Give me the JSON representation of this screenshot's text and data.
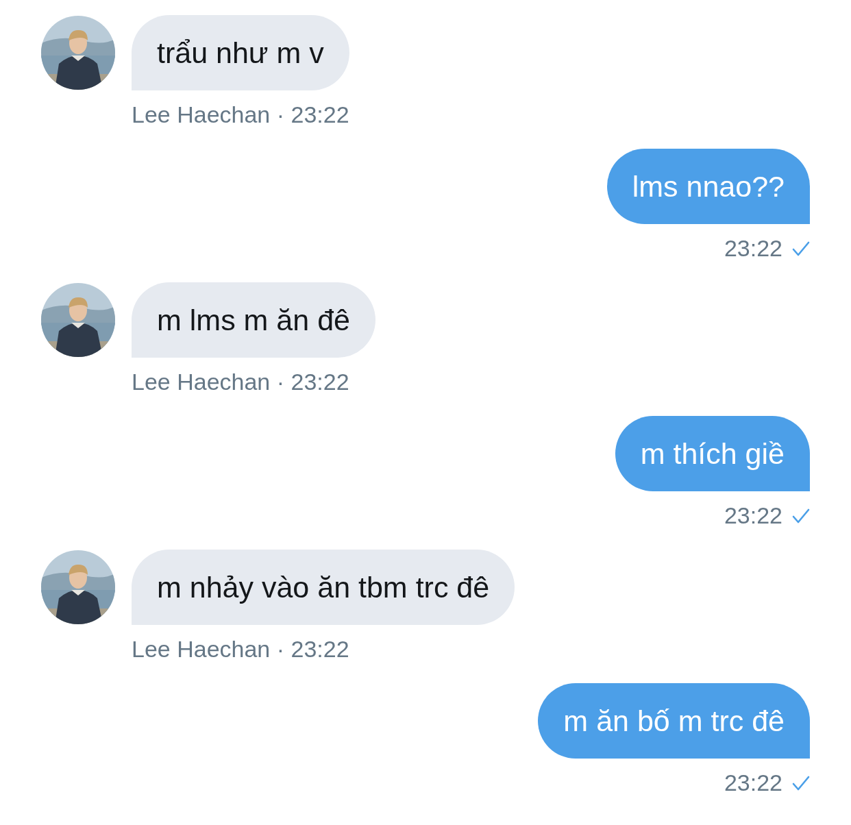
{
  "messages": [
    {
      "kind": "received",
      "text": "trẩu như m v",
      "meta": "Lee Haechan · 23:22"
    },
    {
      "kind": "sent",
      "text": "lms nnao??",
      "time": "23:22",
      "seen": true
    },
    {
      "kind": "received",
      "text": "m lms m ăn đê",
      "meta": "Lee Haechan · 23:22"
    },
    {
      "kind": "sent",
      "text": "m thích giề",
      "time": "23:22",
      "seen": true
    },
    {
      "kind": "received",
      "text": "m nhảy vào ăn tbm trc đê",
      "meta": "Lee Haechan · 23:22"
    },
    {
      "kind": "sent",
      "text": "m ăn bố m trc đê",
      "time": "23:22",
      "seen": true
    }
  ]
}
